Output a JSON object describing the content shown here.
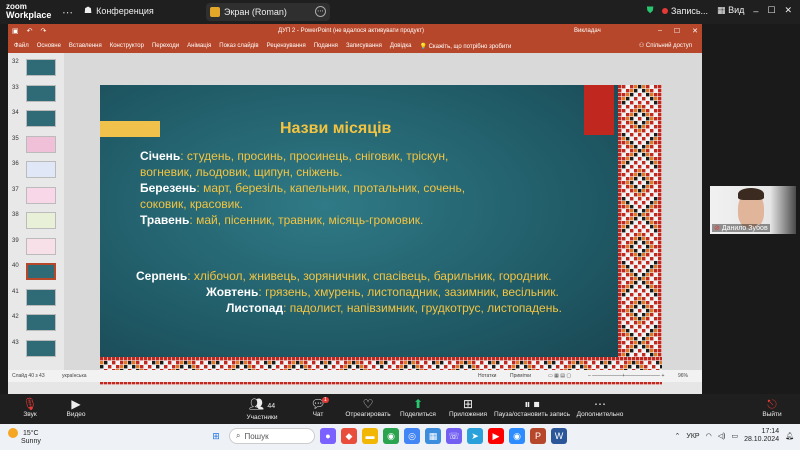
{
  "zoom": {
    "logo_line1": "zoom",
    "logo_line2": "Workplace",
    "meeting_label": "Конференция",
    "screen_share_label": "Экран (Roman)",
    "recording_label": "Запись...",
    "view_label": "Вид"
  },
  "powerpoint": {
    "title": "ДУП 2 - PowerPoint (не вдалося активувати продукт)",
    "user": "Викладач",
    "ribbon_tabs": [
      "Файл",
      "Основне",
      "Вставлення",
      "Конструктор",
      "Переходи",
      "Анімація",
      "Показ слайдів",
      "Рецензування",
      "Подання",
      "Записування",
      "Довідка",
      "Скажіть, що потрібно зробити"
    ],
    "share_label": "Спільний доступ",
    "thumbnails": [
      {
        "num": "32"
      },
      {
        "num": "33"
      },
      {
        "num": "34"
      },
      {
        "num": "35"
      },
      {
        "num": "36"
      },
      {
        "num": "37"
      },
      {
        "num": "38"
      },
      {
        "num": "39"
      },
      {
        "num": "40"
      },
      {
        "num": "41"
      },
      {
        "num": "42"
      },
      {
        "num": "43"
      }
    ],
    "status": {
      "slide_info": "Слайд 40 з 43",
      "language": "українська",
      "notes": "Нотатки",
      "comments": "Примітки",
      "zoom": "96%"
    }
  },
  "slide": {
    "title": "Назви місяців",
    "lines": [
      {
        "month": "Січень",
        "names": ": студень, просинь, просинець, сніговик, тріскун,"
      },
      {
        "month": "",
        "names": "вогневик, льодовик, щипун, сніжень."
      },
      {
        "month": "Березень",
        "names": ": март, березіль, капельник, протальник, сочень,"
      },
      {
        "month": "",
        "names": "соковик, красовик."
      },
      {
        "month": "Травень",
        "names": ": май, пісенник, травник, місяць-громовик."
      },
      {
        "month": "Серпень",
        "names": ": хлібочол, жнивець, зоряничник, спасівець, барильник, городник."
      },
      {
        "month": "Жовтень",
        "names": ": грязень, хмурень, листопадник, зазимник, весільник."
      },
      {
        "month": "Листопад",
        "names": ": падолист, напівзимник, грудкотрус, листопадень."
      }
    ]
  },
  "participant": {
    "name": "Данило Зубов"
  },
  "toolbar": {
    "buttons": [
      {
        "label": "Звук",
        "icon": "mic-off-icon"
      },
      {
        "label": "Видео",
        "icon": "video-icon"
      },
      {
        "label": "Участники",
        "icon": "participants-icon",
        "count": "44"
      },
      {
        "label": "Чат",
        "icon": "chat-icon",
        "badge": "1"
      },
      {
        "label": "Отреагировать",
        "icon": "heart-icon"
      },
      {
        "label": "Поделиться",
        "icon": "share-icon"
      },
      {
        "label": "Приложения",
        "icon": "apps-icon"
      },
      {
        "label": "Пауза/остановить запись",
        "icon": "pause-record-icon"
      },
      {
        "label": "Дополнительно",
        "icon": "more-icon"
      },
      {
        "label": "Выйти",
        "icon": "leave-icon"
      }
    ]
  },
  "taskbar": {
    "temperature": "15°C",
    "weather": "Sunny",
    "search_placeholder": "Пошук",
    "language": "УКР",
    "time": "17:14",
    "date": "28.10.2024"
  },
  "colors": {
    "ppt_red": "#b7472a",
    "slide_gold": "#f4c441",
    "zoom_dark": "#1f1f1f"
  }
}
